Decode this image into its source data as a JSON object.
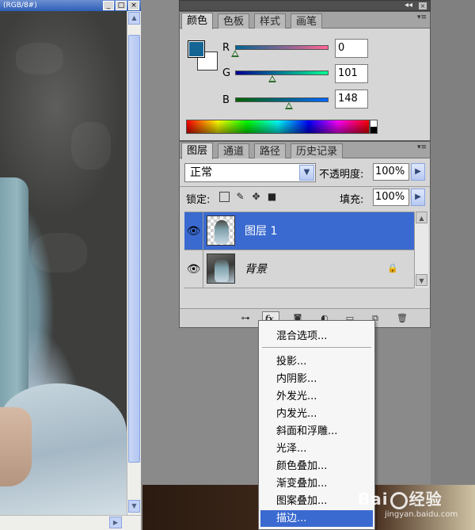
{
  "document_window": {
    "title": "(RGB/8#)",
    "buttons": [
      "_",
      "□",
      "×"
    ]
  },
  "color_panel": {
    "tabs": [
      "颜色",
      "色板",
      "样式",
      "画笔"
    ],
    "foreground_color": "#146594",
    "background_color": "#ffffff",
    "sliders": [
      {
        "label": "R",
        "value": "0",
        "fraction": 0.0
      },
      {
        "label": "G",
        "value": "101",
        "fraction": 0.396
      },
      {
        "label": "B",
        "value": "148",
        "fraction": 0.58
      }
    ]
  },
  "layers_panel": {
    "tabs": [
      "图层",
      "通道",
      "路径",
      "历史记录"
    ],
    "blend_mode": "正常",
    "opacity_label": "不透明度:",
    "opacity_value": "100%",
    "lock_label": "锁定:",
    "fill_label": "填充:",
    "fill_value": "100%",
    "layers": [
      {
        "name": "图层 1",
        "selected": true,
        "visible": true
      },
      {
        "name": "背景",
        "selected": false,
        "visible": true,
        "locked": true
      }
    ],
    "footer_fx": "fx."
  },
  "fx_menu": {
    "items": [
      "混合选项...",
      "投影...",
      "内阴影...",
      "外发光...",
      "内发光...",
      "斜面和浮雕...",
      "光泽...",
      "颜色叠加...",
      "渐变叠加...",
      "图案叠加...",
      "描边..."
    ],
    "highlighted": "描边..."
  },
  "watermark": {
    "logo": "Bai",
    "logo_suffix": "经验",
    "url": "jingyan.baidu.com"
  }
}
